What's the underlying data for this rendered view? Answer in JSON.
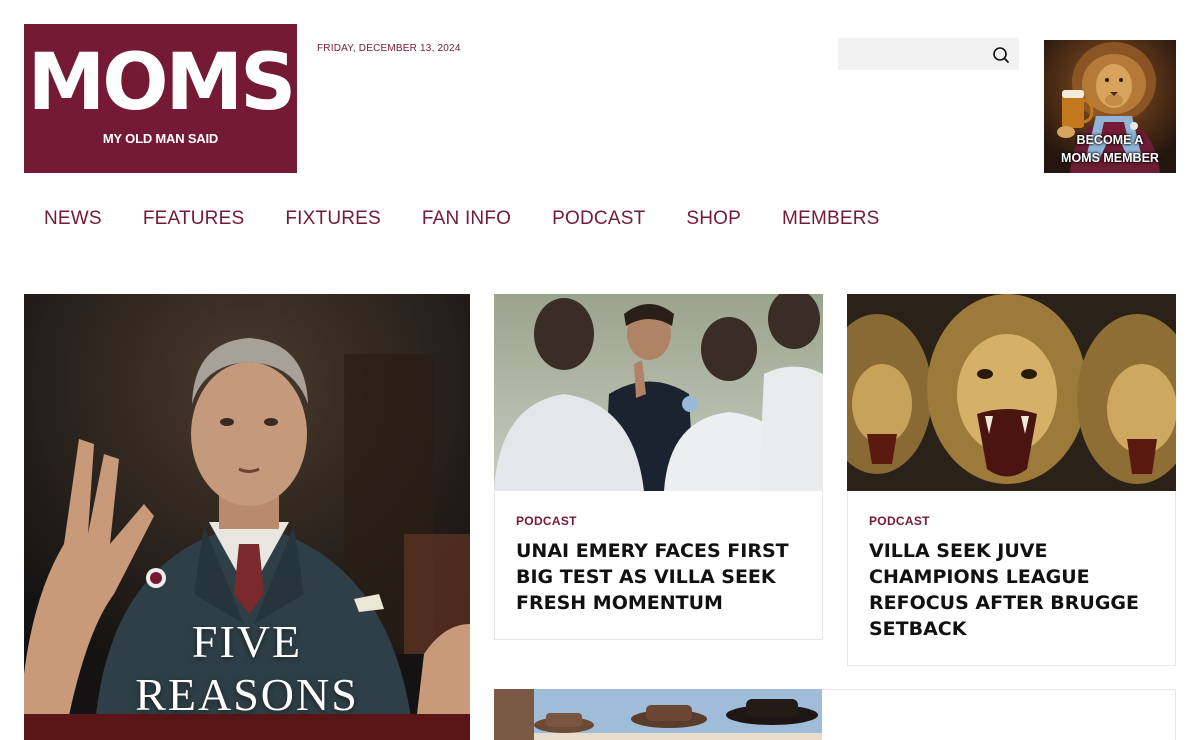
{
  "header": {
    "logo_text": "MOMS",
    "logo_subtitle": "MY OLD MAN SAID",
    "date": "FRIDAY, DECEMBER 13, 2024",
    "search_value": "",
    "search_icon": "search-icon",
    "promo_line1": "BECOME A",
    "promo_line2": "MOMS MEMBER"
  },
  "nav": {
    "items": [
      "NEWS",
      "FEATURES",
      "FIXTURES",
      "FAN INFO",
      "PODCAST",
      "SHOP",
      "MEMBERS"
    ]
  },
  "featured": {
    "title_line1": "FIVE",
    "title_line2": "REASONS"
  },
  "cards": [
    {
      "category": "PODCAST",
      "title": "UNAI EMERY FACES FIRST BIG TEST AS VILLA SEEK FRESH MOMENTUM"
    },
    {
      "category": "PODCAST",
      "title": "VILLA SEEK JUVE CHAMPIONS LEAGUE REFOCUS AFTER BRUGGE SETBACK"
    }
  ],
  "colors": {
    "brand": "#741a35",
    "search_bg": "#f2f2f2",
    "card_border": "#e6e6e6"
  }
}
